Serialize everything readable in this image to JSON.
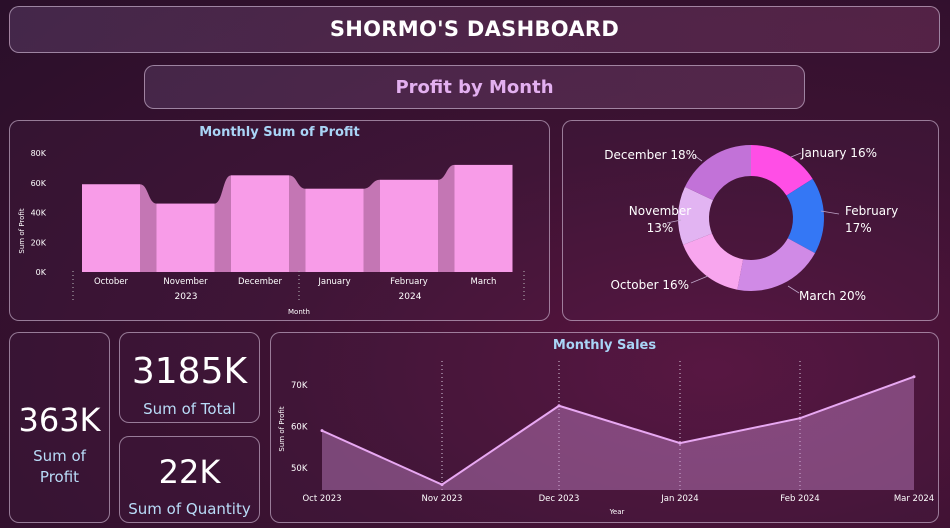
{
  "header": {
    "title": "SHORMO'S DASHBOARD",
    "subtitle": "Profit by Month"
  },
  "bar_chart": {
    "title": "Monthly Sum of Profit",
    "ylabel": "Sum of Profit",
    "xlabel": "Month",
    "yticks": [
      "80K",
      "60K",
      "40K",
      "20K",
      "0K"
    ],
    "year_labels": [
      "2023",
      "2024"
    ]
  },
  "donut": {
    "labels": [
      "January 16%",
      "February\n17%",
      "March 20%",
      "October 16%",
      "November\n13%",
      "December 18%"
    ]
  },
  "kpis": {
    "profit": {
      "value": "363K",
      "label": "Sum of\nProfit"
    },
    "total": {
      "value": "3185K",
      "label": "Sum of Total"
    },
    "quantity": {
      "value": "22K",
      "label": "Sum of Quantity"
    }
  },
  "line_chart": {
    "title": "Monthly Sales",
    "ylabel": "Sum of Profit",
    "xlabel": "Year",
    "yticks": [
      "70K",
      "60K",
      "50K"
    ]
  },
  "colors": {
    "bar": "#f89ce8",
    "bar_shadow": "#c476b4",
    "line": "#e8a8f2",
    "donut_january": "#ff4ee6",
    "donut_february": "#3477f5",
    "donut_march": "#d08ae6",
    "donut_october": "#f8a6ee",
    "donut_november": "#e2b4f2",
    "donut_december": "#c272d8"
  },
  "chart_data": [
    {
      "type": "bar",
      "title": "Monthly Sum of Profit",
      "xlabel": "Month",
      "ylabel": "Sum of Profit",
      "categories": [
        "October",
        "November",
        "December",
        "January",
        "February",
        "March"
      ],
      "values": [
        59000,
        46000,
        65000,
        56000,
        62000,
        72000
      ],
      "ylim": [
        0,
        80000
      ]
    },
    {
      "type": "pie",
      "categories": [
        "January",
        "February",
        "March",
        "October",
        "November",
        "December"
      ],
      "values": [
        16,
        17,
        20,
        16,
        13,
        18
      ]
    },
    {
      "type": "area",
      "title": "Monthly Sales",
      "xlabel": "Year",
      "ylabel": "Sum of Profit",
      "categories": [
        "Oct 2023",
        "Nov 2023",
        "Dec 2023",
        "Jan 2024",
        "Feb 2024",
        "Mar 2024"
      ],
      "values": [
        59000,
        46000,
        65000,
        56000,
        62000,
        72000
      ],
      "ylim": [
        45000,
        75000
      ]
    }
  ]
}
